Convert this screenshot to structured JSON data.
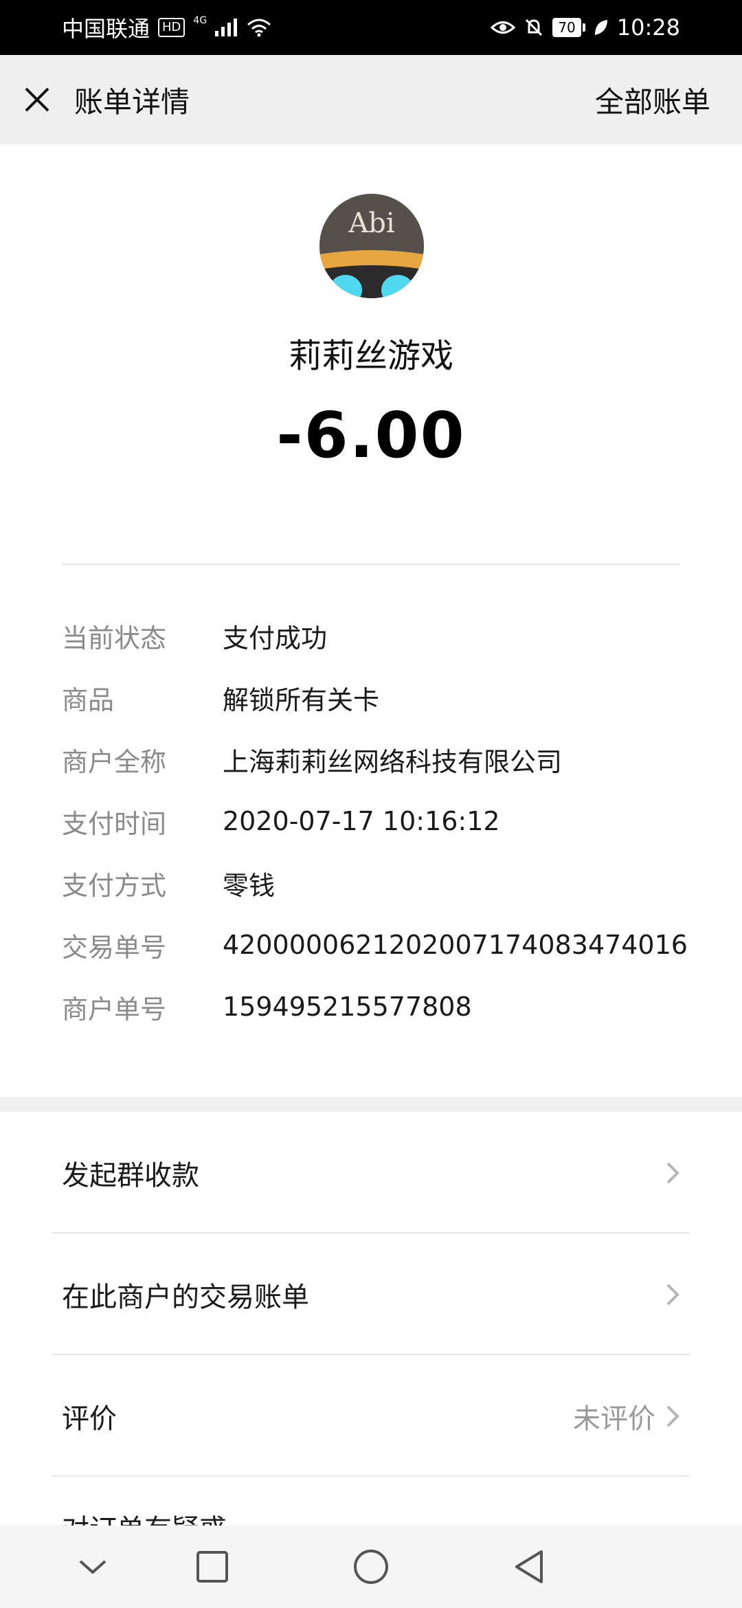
{
  "status_bar": {
    "carrier": "中国联通",
    "hd": "HD",
    "network": "4G",
    "battery": "70",
    "time": "10:28"
  },
  "header": {
    "title": "账单详情",
    "all_bills": "全部账单"
  },
  "merchant": {
    "avatar_text": "Abi",
    "name": "莉莉丝游戏",
    "amount": "-6.00"
  },
  "details": [
    {
      "label": "当前状态",
      "value": "支付成功"
    },
    {
      "label": "商品",
      "value": "解锁所有关卡"
    },
    {
      "label": "商户全称",
      "value": "上海莉莉丝网络科技有限公司"
    },
    {
      "label": "支付时间",
      "value": "2020-07-17 10:16:12"
    },
    {
      "label": "支付方式",
      "value": "零钱"
    },
    {
      "label": "交易单号",
      "value": "4200000621202007174083474016"
    },
    {
      "label": "商户单号",
      "value": "159495215577808"
    }
  ],
  "actions": [
    {
      "label": "发起群收款",
      "status": ""
    },
    {
      "label": "在此商户的交易账单",
      "status": ""
    },
    {
      "label": "评价",
      "status": "未评价"
    },
    {
      "label": "对订单有疑惑",
      "status": ""
    }
  ],
  "icons": {
    "close": "close-icon",
    "chevron": "chevron-right-icon",
    "nav_down": "chevron-down-icon",
    "nav_recent": "square-icon",
    "nav_home": "circle-icon",
    "nav_back": "triangle-back-icon"
  },
  "colors": {
    "header_bg": "#efefef",
    "label_gray": "#8a8a8a",
    "status_bar_bg": "#000000"
  }
}
